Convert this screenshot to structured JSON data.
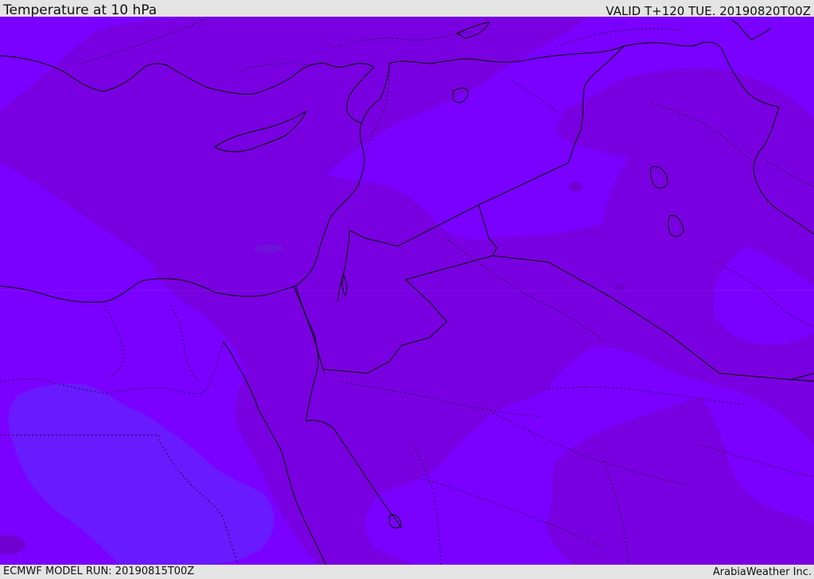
{
  "header": {
    "title": "Temperature at 10 hPa",
    "valid_label": "VALID T+120 TUE. 20190820T00Z"
  },
  "footer": {
    "model_run": "ECMWF MODEL RUN: 20190815T00Z",
    "brand": "ArabiaWeather Inc."
  },
  "map": {
    "field": "temperature",
    "pressure_level": "10 hPa",
    "colors": {
      "base": "#7a00ff",
      "warm": "#7900e0",
      "cold": "#6a1aff",
      "coast": "#000000",
      "borders": "#1a0033"
    }
  }
}
